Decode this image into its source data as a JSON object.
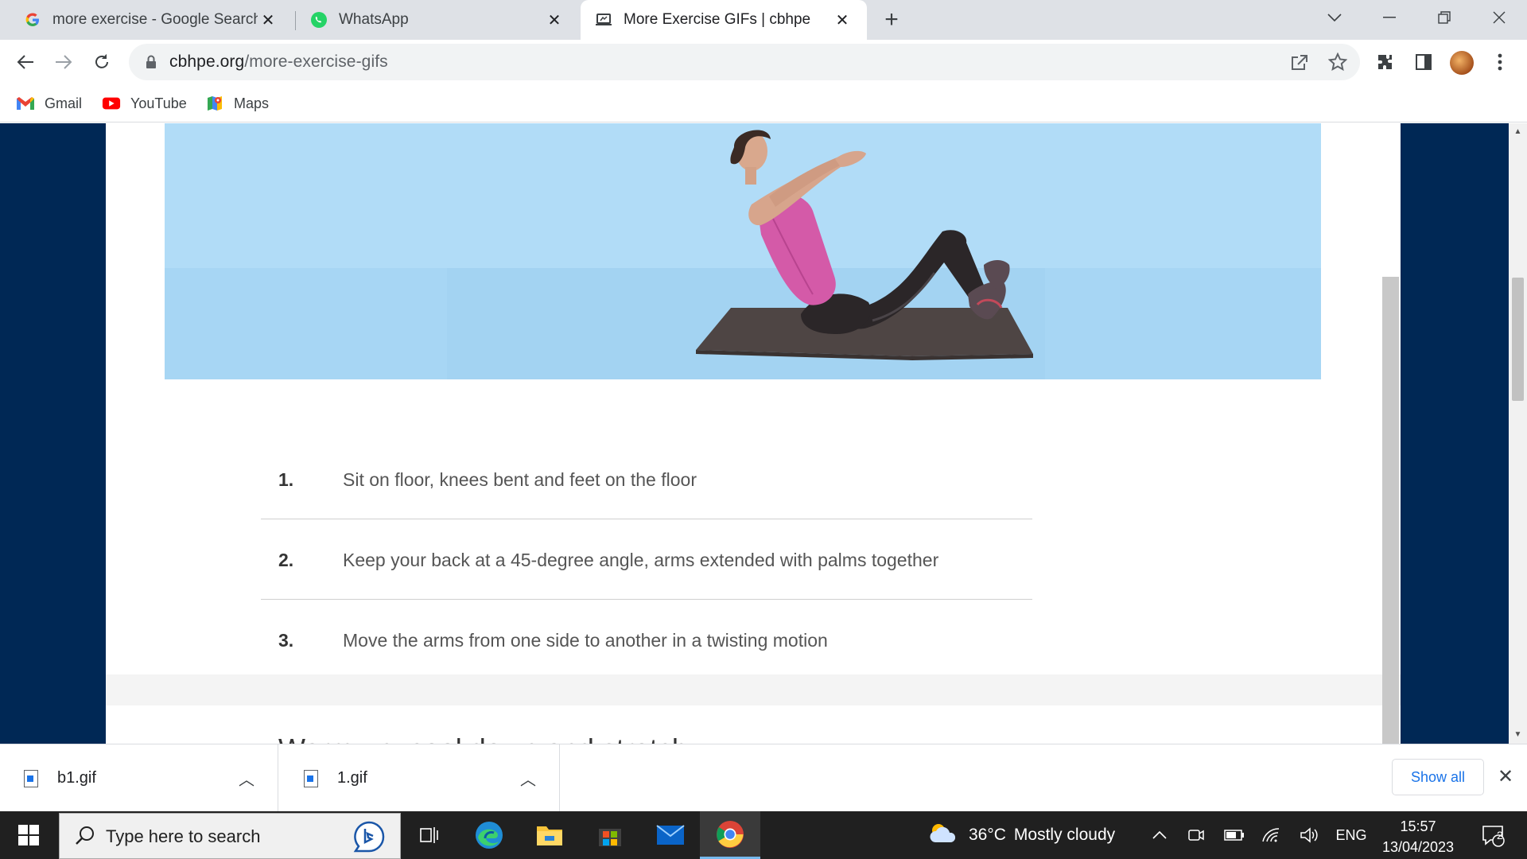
{
  "tabs": [
    {
      "title": "more exercise - Google Search",
      "icon": "google-icon"
    },
    {
      "title": "WhatsApp",
      "icon": "whatsapp-icon"
    },
    {
      "title": "More Exercise GIFs | cbhpe",
      "icon": "site-icon",
      "active": true
    }
  ],
  "address": {
    "domain": "cbhpe.org",
    "path": "/more-exercise-gifs"
  },
  "bookmarks": [
    {
      "label": "Gmail",
      "icon": "gmail-icon"
    },
    {
      "label": "YouTube",
      "icon": "youtube-icon"
    },
    {
      "label": "Maps",
      "icon": "maps-icon"
    }
  ],
  "content": {
    "steps": [
      {
        "num": "1.",
        "text": "Sit on floor, knees bent and feet on the floor"
      },
      {
        "num": "2.",
        "text": "Keep your back at a 45-degree angle, arms extended with palms together"
      },
      {
        "num": "3.",
        "text": "Move the arms from one side to another in a twisting motion"
      }
    ],
    "next_heading": "Warm up, cool down and stretch"
  },
  "downloads": {
    "items": [
      {
        "name": "b1.gif"
      },
      {
        "name": "1.gif"
      }
    ],
    "show_all": "Show all"
  },
  "taskbar": {
    "search_placeholder": "Type here to search",
    "weather_temp": "36°C",
    "weather_desc": "Mostly cloudy",
    "language": "ENG",
    "time": "15:57",
    "date": "13/04/2023",
    "notifications": "2"
  },
  "colors": {
    "page_bg": "#002855",
    "gif_sky": "#b1dcf7",
    "link_blue": "#1a73e8",
    "taskbar": "#202020"
  }
}
